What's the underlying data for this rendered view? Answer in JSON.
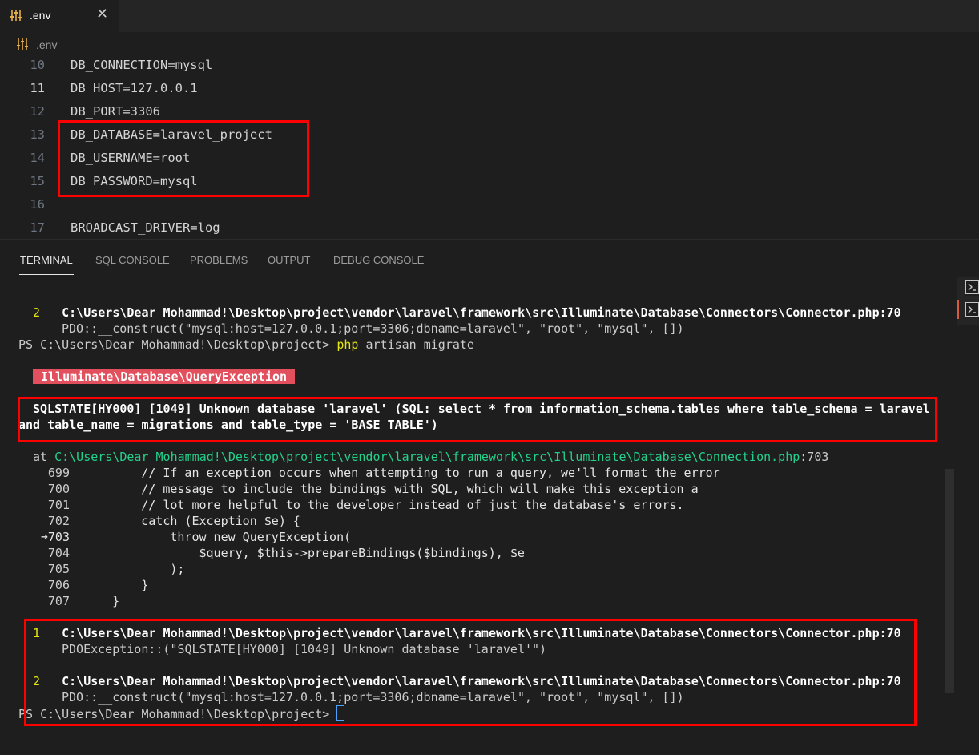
{
  "tab": {
    "label": ".env",
    "close": "✕"
  },
  "breadcrumb": {
    "label": ".env"
  },
  "editor": {
    "lines": [
      {
        "num": "10",
        "text": "DB_CONNECTION=mysql"
      },
      {
        "num": "11",
        "text": "DB_HOST=127.0.0.1"
      },
      {
        "num": "12",
        "text": "DB_PORT=3306"
      },
      {
        "num": "13",
        "text": "DB_DATABASE=laravel_project"
      },
      {
        "num": "14",
        "text": "DB_USERNAME=root"
      },
      {
        "num": "15",
        "text": "DB_PASSWORD=mysql"
      },
      {
        "num": "16",
        "text": ""
      },
      {
        "num": "17",
        "text": "BROADCAST_DRIVER=log"
      }
    ]
  },
  "panel": {
    "tabs": [
      "TERMINAL",
      "SQL CONSOLE",
      "PROBLEMS",
      "OUTPUT",
      "DEBUG CONSOLE"
    ]
  },
  "terminal": {
    "top_frame_num": "2",
    "top_frame_path": "C:\\Users\\Dear Mohammad!\\Desktop\\project\\vendor\\laravel\\framework\\src\\Illuminate\\Database\\Connectors\\Connector.php",
    "top_frame_line": ":70",
    "top_frame_call": "PDO::__construct(\"mysql:host=127.0.0.1;port=3306;dbname=laravel\", \"root\", \"mysql\", [])",
    "prompt": "PS C:\\Users\\Dear Mohammad!\\Desktop\\project> ",
    "cmd_php": "php",
    "cmd_rest": " artisan migrate",
    "exception": "Illuminate\\Database\\QueryException",
    "error_line1": "SQLSTATE[HY000] [1049] Unknown database 'laravel' (SQL: select * from information_schema.tables where table_schema = laravel",
    "error_line2": "and table_name = migrations and table_type = 'BASE TABLE')",
    "at_label": "at ",
    "at_path": "C:\\Users\\Dear Mohammad!\\Desktop\\project\\vendor\\laravel\\framework\\src\\Illuminate\\Database\\Connection.php",
    "at_line": ":703",
    "code": [
      {
        "num": "699",
        "text": "        // If an exception occurs when attempting to run a query, we'll format the error"
      },
      {
        "num": "700",
        "text": "        // message to include the bindings with SQL, which will make this exception a"
      },
      {
        "num": "701",
        "text": "        // lot more helpful to the developer instead of just the database's errors."
      },
      {
        "num": "702",
        "text": "        catch (Exception $e) {"
      },
      {
        "num": "➜703",
        "text": "            throw new QueryException("
      },
      {
        "num": "704",
        "text": "                $query, $this->prepareBindings($bindings), $e"
      },
      {
        "num": "705",
        "text": "            );"
      },
      {
        "num": "706",
        "text": "        }"
      },
      {
        "num": "707",
        "text": "    }"
      }
    ],
    "frames": [
      {
        "num": "1",
        "path": "C:\\Users\\Dear Mohammad!\\Desktop\\project\\vendor\\laravel\\framework\\src\\Illuminate\\Database\\Connectors\\Connector.php",
        "line": ":70",
        "call": "PDOException::(\"SQLSTATE[HY000] [1049] Unknown database 'laravel'\")"
      },
      {
        "num": "2",
        "path": "C:\\Users\\Dear Mohammad!\\Desktop\\project\\vendor\\laravel\\framework\\src\\Illuminate\\Database\\Connectors\\Connector.php",
        "line": ":70",
        "call": "PDO::__construct(\"mysql:host=127.0.0.1;port=3306;dbname=laravel\", \"root\", \"mysql\", [])"
      }
    ],
    "final_prompt": "PS C:\\Users\\Dear Mohammad!\\Desktop\\project> "
  }
}
